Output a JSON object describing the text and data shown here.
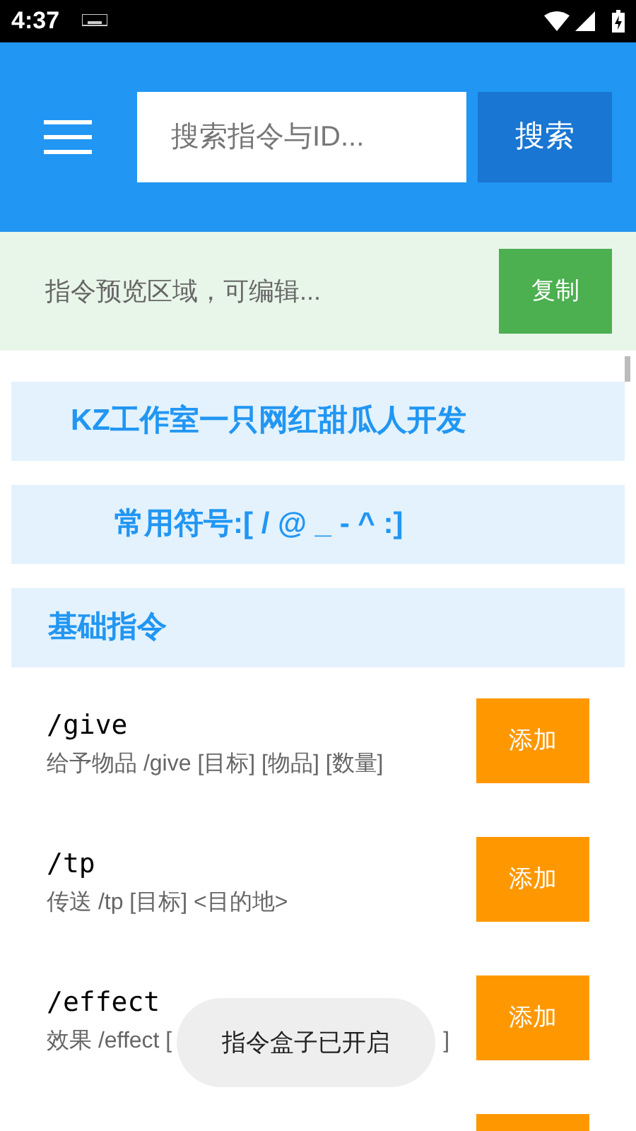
{
  "status_bar": {
    "time": "4:37"
  },
  "header": {
    "search": {
      "placeholder": "搜索指令与ID..."
    },
    "search_button": "搜索"
  },
  "preview": {
    "placeholder": "指令预览区域，可编辑...",
    "copy_button": "复制"
  },
  "banners": [
    {
      "text": "KZ工作室一只网红甜瓜人开发",
      "indent": false
    },
    {
      "text": "常用符号:[ / @ _ - ^ :]",
      "indent": true
    }
  ],
  "section": {
    "title": "基础指令"
  },
  "commands": [
    {
      "name": "/give",
      "description": "给予物品 /give [目标] [物品] [数量]",
      "button": "添加"
    },
    {
      "name": "/tp",
      "description": "传送 /tp [目标] <目的地>",
      "button": "添加"
    },
    {
      "name": "/effect",
      "description": "效果 /effect [",
      "description_end": "]",
      "button": "添加"
    }
  ],
  "toast": "指令盒子已开启"
}
